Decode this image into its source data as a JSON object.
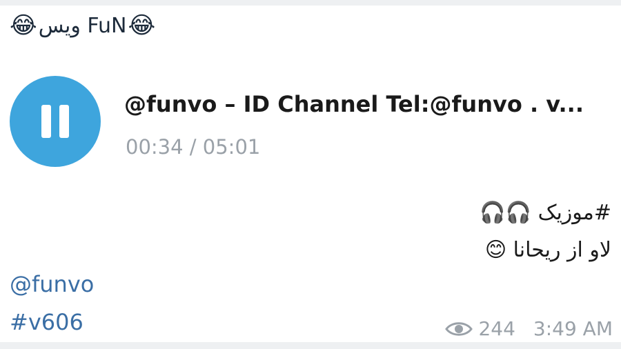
{
  "message": {
    "title_emoji": "😂",
    "title_text": "ویس FuN",
    "audio": {
      "title": "@funvo – ID Channel Tel:@funvo . v...",
      "time": "00:34 / 05:01"
    },
    "rtl_line1": "#موزیک 🎧🎧",
    "rtl_line2": "لاو از ریحانا 😊",
    "handle": "@funvo",
    "tag": "#v606",
    "views": "244",
    "timestamp": "3:49 AM"
  },
  "colors": {
    "accent": "#3ea5dd",
    "meta": "#9aa1a8",
    "link": "#3a6ea5"
  },
  "icons": {
    "play_state": "pause-icon",
    "views": "eye-icon"
  }
}
